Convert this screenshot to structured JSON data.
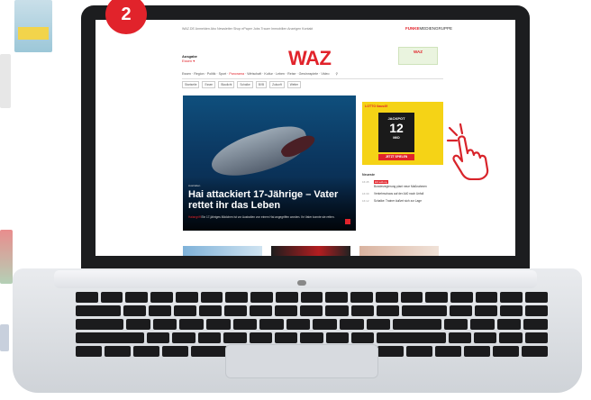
{
  "step_badge": "2",
  "website": {
    "top_links": "WAZ.DE   Anmelden  Abo  Newsletter  Shop  ePaper  Jobs  Trauer  Immobilien  Anzeigen  Kontakt",
    "group_brand": "FUNKE",
    "group_brand_suffix": "MEDIENGRUPPE",
    "region_label": "Ausgabe",
    "region_value": "Essen ▾",
    "logo": "WAZ",
    "promo_brand": "WAZ",
    "nav": {
      "items": [
        "Essen",
        "Region",
        "Politik",
        "Sport",
        "Panorama",
        "Wirtschaft",
        "Kultur",
        "Leben",
        "Reise",
        "Gewinnspiele",
        "Video"
      ],
      "active": "Panorama"
    },
    "subnav": [
      "Startseite",
      "Essen",
      "Blaulicht",
      "Schalke",
      "BVB",
      "Zukunft",
      "Wetter"
    ],
    "hero": {
      "kicker": "Australien",
      "title": "Hai attackiert 17-Jährige – Vater rettet ihr das Leben",
      "teaser_label": "Haiangriff",
      "teaser": "Ein 17-jähriges Mädchen ist vor Australien von einem Hai angegriffen worden. Ihr Vater konnte sie retten."
    },
    "jackpot": {
      "brand": "LOTTO 6aus49",
      "label": "JACKPOT",
      "amount": "12",
      "unit": "MIO",
      "cta": "JETZT SPIELEN"
    },
    "news": {
      "heading": "Neueste",
      "items": [
        {
          "time": "16:45",
          "tag": "Eilmeldung",
          "text": "Bundesregierung plant neue Maßnahmen"
        },
        {
          "time": "16:30",
          "tag": "",
          "text": "Verkehrschaos auf der A40 nach Unfall"
        },
        {
          "time": "16:12",
          "tag": "",
          "text": "Schalke: Trainer äußert sich zur Lage"
        }
      ]
    }
  }
}
